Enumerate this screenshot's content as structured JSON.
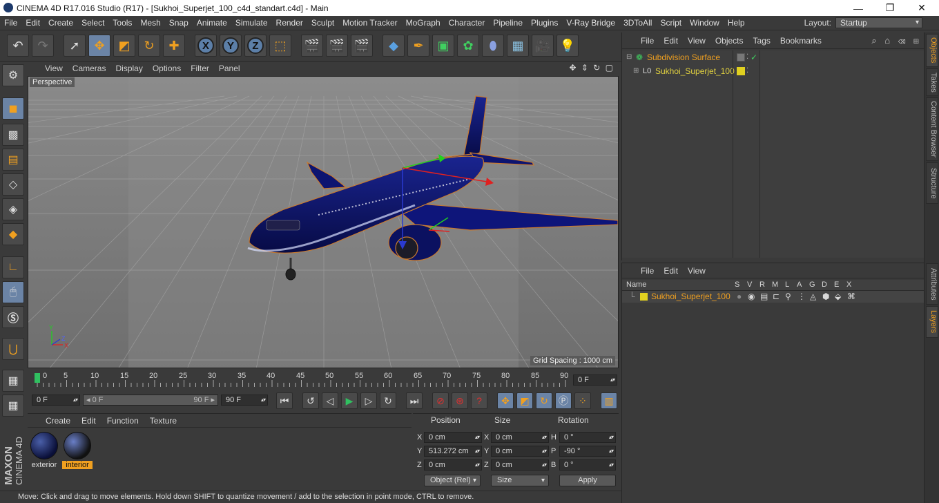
{
  "window": {
    "title": "CINEMA 4D R17.016 Studio (R17) - [Sukhoi_Superjet_100_c4d_standart.c4d] - Main",
    "minimize": "—",
    "maximize": "❐",
    "close": "✕"
  },
  "menubar": {
    "items": [
      "File",
      "Edit",
      "Create",
      "Select",
      "Tools",
      "Mesh",
      "Snap",
      "Animate",
      "Simulate",
      "Render",
      "Sculpt",
      "Motion Tracker",
      "MoGraph",
      "Character",
      "Pipeline",
      "Plugins",
      "V-Ray Bridge",
      "3DToAll",
      "Script",
      "Window",
      "Help"
    ],
    "layout_label": "Layout:",
    "layout_value": "Startup"
  },
  "toolbar": {
    "axis_x": "X",
    "axis_y": "Y",
    "axis_z": "Z"
  },
  "viewport": {
    "menu": [
      "View",
      "Cameras",
      "Display",
      "Options",
      "Filter",
      "Panel"
    ],
    "camera_label": "Perspective",
    "grid_spacing": "Grid Spacing : 1000 cm",
    "nav_icons": "✥ ⇕ ↻ ▢"
  },
  "timeline": {
    "ticks": [
      "0",
      "5",
      "10",
      "15",
      "20",
      "25",
      "30",
      "35",
      "40",
      "45",
      "50",
      "55",
      "60",
      "65",
      "70",
      "75",
      "80",
      "85",
      "90"
    ],
    "current_frame": "0 F"
  },
  "playback": {
    "start_field": "0 F",
    "range_start": "◂ 0 F",
    "range_end": "90 F ▸",
    "end_field": "90 F"
  },
  "materials": {
    "menu": [
      "Create",
      "Edit",
      "Function",
      "Texture"
    ],
    "items": [
      {
        "name": "exterior",
        "selected": false
      },
      {
        "name": "interior",
        "selected": true
      }
    ]
  },
  "coordinates": {
    "headers": {
      "position": "Position",
      "size": "Size",
      "rotation": "Rotation"
    },
    "axes": {
      "x": "X",
      "y": "Y",
      "z": "Z",
      "h": "H",
      "p": "P",
      "b": "B"
    },
    "position": {
      "x": "0 cm",
      "y": "513.272 cm",
      "z": "0 cm"
    },
    "size": {
      "x": "0 cm",
      "y": "0 cm",
      "z": "0 cm"
    },
    "rotation": {
      "h": "0 °",
      "p": "-90 °",
      "b": "0 °"
    },
    "mode": "Object (Rel)",
    "size_mode": "Size",
    "apply": "Apply"
  },
  "status": "Move: Click and drag to move elements. Hold down SHIFT to quantize movement / add to the selection in point mode, CTRL to remove.",
  "objects_panel": {
    "menu": [
      "File",
      "Edit",
      "View",
      "Objects",
      "Tags",
      "Bookmarks"
    ],
    "tree": [
      {
        "name": "Subdivision Surface"
      },
      {
        "name": "Sukhoi_Superjet_100"
      }
    ]
  },
  "layers_panel": {
    "menu": [
      "File",
      "Edit",
      "View"
    ],
    "columns": [
      "Name",
      "S",
      "V",
      "R",
      "M",
      "L",
      "A",
      "G",
      "D",
      "E",
      "X"
    ],
    "rows": [
      {
        "name": "Sukhoi_Superjet_100",
        "color": "#e0d020"
      }
    ]
  },
  "side_tabs": [
    "Objects",
    "Takes",
    "Content Browser",
    "Structure",
    "Attributes",
    "Layers"
  ],
  "brand": {
    "line1": "MAXON",
    "line2": "CINEMA 4D"
  },
  "colors": {
    "accent": "#f0a020",
    "active_tool": "#6b84a6",
    "plane": "#0b1160"
  }
}
